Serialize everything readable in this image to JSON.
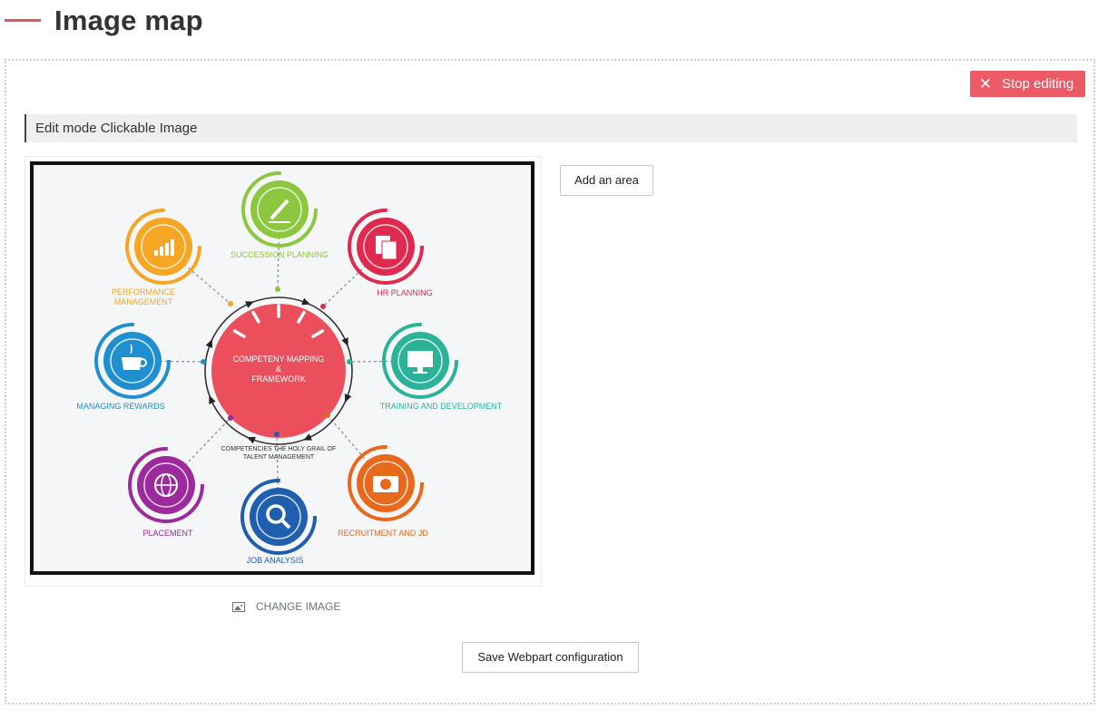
{
  "page": {
    "title": "Image map"
  },
  "toolbar": {
    "stop_editing_label": "Stop editing"
  },
  "mode_bar": {
    "label": "Edit mode Clickable Image"
  },
  "image": {
    "center_title_lines": [
      "COMPETENY MAPPING",
      "&",
      "FRAMEWORK"
    ],
    "caption_lines": [
      "COMPETENCIES THE HOLY GRAIL OF",
      "TALENT MANAGEMENT"
    ],
    "nodes": [
      {
        "key": "succession",
        "lines": [
          "SUCCESSION PLANNING"
        ],
        "color": "#8dc63f",
        "icon": "pencil-icon"
      },
      {
        "key": "hr",
        "lines": [
          "HR PLANNING"
        ],
        "color": "#e0294f",
        "icon": "documents-icon"
      },
      {
        "key": "training",
        "lines": [
          "TRAINING AND DEVELOPMENT"
        ],
        "color": "#2bb39a",
        "icon": "monitor-icon"
      },
      {
        "key": "recruitment",
        "lines": [
          "RECRUITMENT AND JD"
        ],
        "color": "#e8681c",
        "icon": "camera-icon"
      },
      {
        "key": "job",
        "lines": [
          "JOB ANALYSIS"
        ],
        "color": "#1f5fae",
        "icon": "magnifier-icon"
      },
      {
        "key": "placement",
        "lines": [
          "PLACEMENT"
        ],
        "color": "#9c2a9c",
        "icon": "globe-icon"
      },
      {
        "key": "rewards",
        "lines": [
          "MANAGING REWARDS"
        ],
        "color": "#1f8fd0",
        "icon": "cup-icon"
      },
      {
        "key": "performance",
        "lines": [
          "PERFORMANCE",
          "MANAGEMENT"
        ],
        "color": "#f5a623",
        "icon": "bar-chart-icon"
      }
    ],
    "center_color": "#ea4f5b"
  },
  "actions": {
    "add_area_label": "Add an area",
    "change_image_label": "CHANGE IMAGE",
    "save_label": "Save Webpart configuration"
  }
}
